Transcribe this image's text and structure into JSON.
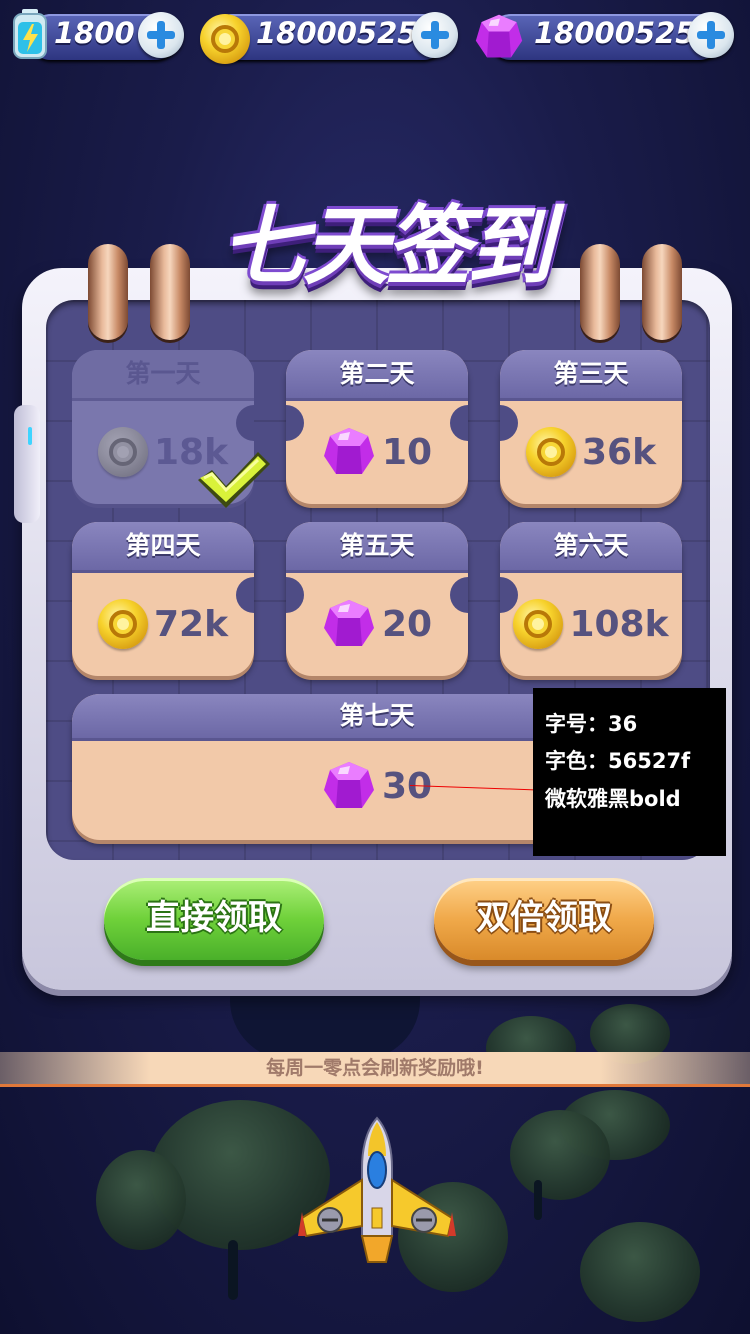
{
  "resources": {
    "energy": {
      "value": "1800",
      "icon": "battery-icon"
    },
    "coins": {
      "value": "18000525",
      "icon": "coin-icon"
    },
    "gems": {
      "value": "18000525",
      "icon": "gem-icon"
    }
  },
  "title": "七天签到",
  "days": [
    {
      "label": "第一天",
      "reward": "18k",
      "icon": "coin-icon",
      "claimed": true
    },
    {
      "label": "第二天",
      "reward": "10",
      "icon": "gem-icon",
      "claimed": false
    },
    {
      "label": "第三天",
      "reward": "36k",
      "icon": "coin-icon",
      "claimed": false
    },
    {
      "label": "第四天",
      "reward": "72k",
      "icon": "coin-icon",
      "claimed": false
    },
    {
      "label": "第五天",
      "reward": "20",
      "icon": "gem-icon",
      "claimed": false
    },
    {
      "label": "第六天",
      "reward": "108k",
      "icon": "coin-icon",
      "claimed": false
    },
    {
      "label": "第七天",
      "reward": "30",
      "icon": "gem-icon",
      "claimed": false
    }
  ],
  "buttons": {
    "claim": "直接领取",
    "double_claim": "双倍领取"
  },
  "notice": "每周一零点会刷新奖励哦!",
  "annotation": {
    "line1": "字号：36",
    "line2": "字色：56527f",
    "line3": "微软雅黑bold"
  },
  "colors": {
    "reward_text": "#56527f",
    "card_bg": "#f2c9a9",
    "board_inner": "#4e4c85"
  }
}
